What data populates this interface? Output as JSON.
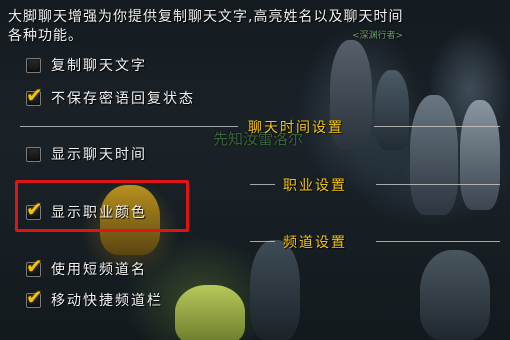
{
  "description": {
    "line1": "大脚聊天增强为你提供复制聊天文字,高亮姓名以及聊天时间",
    "line2": "各种功能。"
  },
  "scene_text": {
    "top_label": "<深渊行者>",
    "watermark": "先知汝雷洛尔"
  },
  "options": {
    "copy_chat_text": {
      "label": "复制聊天文字",
      "checked": false
    },
    "no_save_whisper_reply": {
      "label": "不保存密语回复状态",
      "checked": true
    },
    "show_chat_time": {
      "label": "显示聊天时间",
      "checked": false
    },
    "show_class_color": {
      "label": "显示职业颜色",
      "checked": true
    },
    "use_short_channel_name": {
      "label": "使用短频道名",
      "checked": true
    },
    "move_quick_channel_bar": {
      "label": "移动快捷频道栏",
      "checked": true
    }
  },
  "sections": {
    "chat_time_settings": "聊天时间设置",
    "class_settings": "职业设置",
    "channel_settings": "频道设置"
  },
  "colors": {
    "section_title": "#f4c20d",
    "checkmark": "#f2c400",
    "highlight_box": "#e01414",
    "label_text": "#f0f0f0"
  }
}
